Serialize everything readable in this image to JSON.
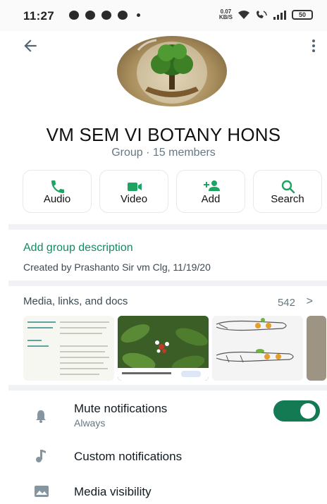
{
  "status_bar": {
    "time": "11:27",
    "net_speed_value": "0.07",
    "net_speed_unit": "KB/S",
    "battery": "50"
  },
  "header": {
    "back_icon": "arrow-back-icon",
    "menu_icon": "more-vert-icon"
  },
  "group": {
    "name": "VM SEM VI  BOTANY HONS",
    "subtitle": "Group · 15 members"
  },
  "actions": [
    {
      "label": "Audio",
      "icon": "phone-icon"
    },
    {
      "label": "Video",
      "icon": "video-icon"
    },
    {
      "label": "Add",
      "icon": "add-person-icon"
    },
    {
      "label": "Search",
      "icon": "search-icon"
    }
  ],
  "description": {
    "add_link": "Add group description",
    "created": "Created by Prashanto Sir vm Clg, 11/19/20"
  },
  "media": {
    "title": "Media, links, and docs",
    "count": "542",
    "chevron": ">"
  },
  "settings": [
    {
      "label": "Mute notifications",
      "sub": "Always",
      "icon": "bell-icon",
      "toggle_on": true
    },
    {
      "label": "Custom notifications",
      "icon": "music-note-icon"
    },
    {
      "label": "Media visibility",
      "icon": "image-icon"
    }
  ],
  "colors": {
    "accent": "#128c5e",
    "toggle": "#137a54",
    "icon_green": "#1da463"
  }
}
